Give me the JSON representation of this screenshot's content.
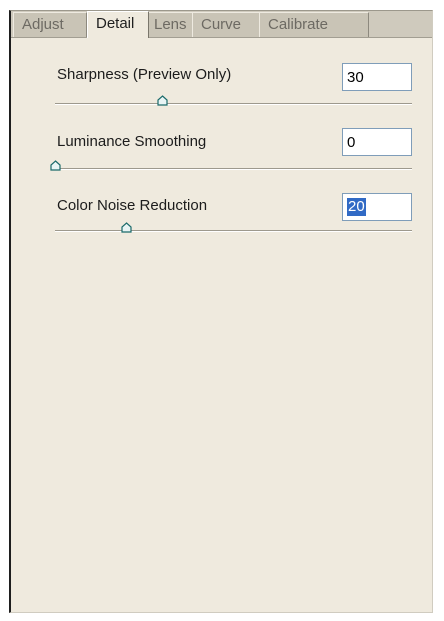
{
  "tabs": [
    {
      "label": "Adjust",
      "active": false
    },
    {
      "label": "Detail",
      "active": true
    },
    {
      "label": "Lens",
      "active": false
    },
    {
      "label": "Curve",
      "active": false
    },
    {
      "label": "Calibrate",
      "active": false
    }
  ],
  "controls": [
    {
      "label": "Sharpness  (Preview Only)",
      "value": "30",
      "level_percent": 30,
      "selected": false
    },
    {
      "label": "Luminance Smoothing",
      "value": "0",
      "level_percent": 0,
      "selected": false
    },
    {
      "label": "Color Noise Reduction",
      "value": "20",
      "level_percent": 20,
      "selected": true
    }
  ],
  "colors": {
    "panel_bg": "#efeade",
    "tab_bg": "#c9c4b6",
    "input_border": "#7f9db9",
    "selection": "#316ac5",
    "thumb_fill": "#e8f4f4",
    "thumb_stroke": "#1a6a6a"
  }
}
